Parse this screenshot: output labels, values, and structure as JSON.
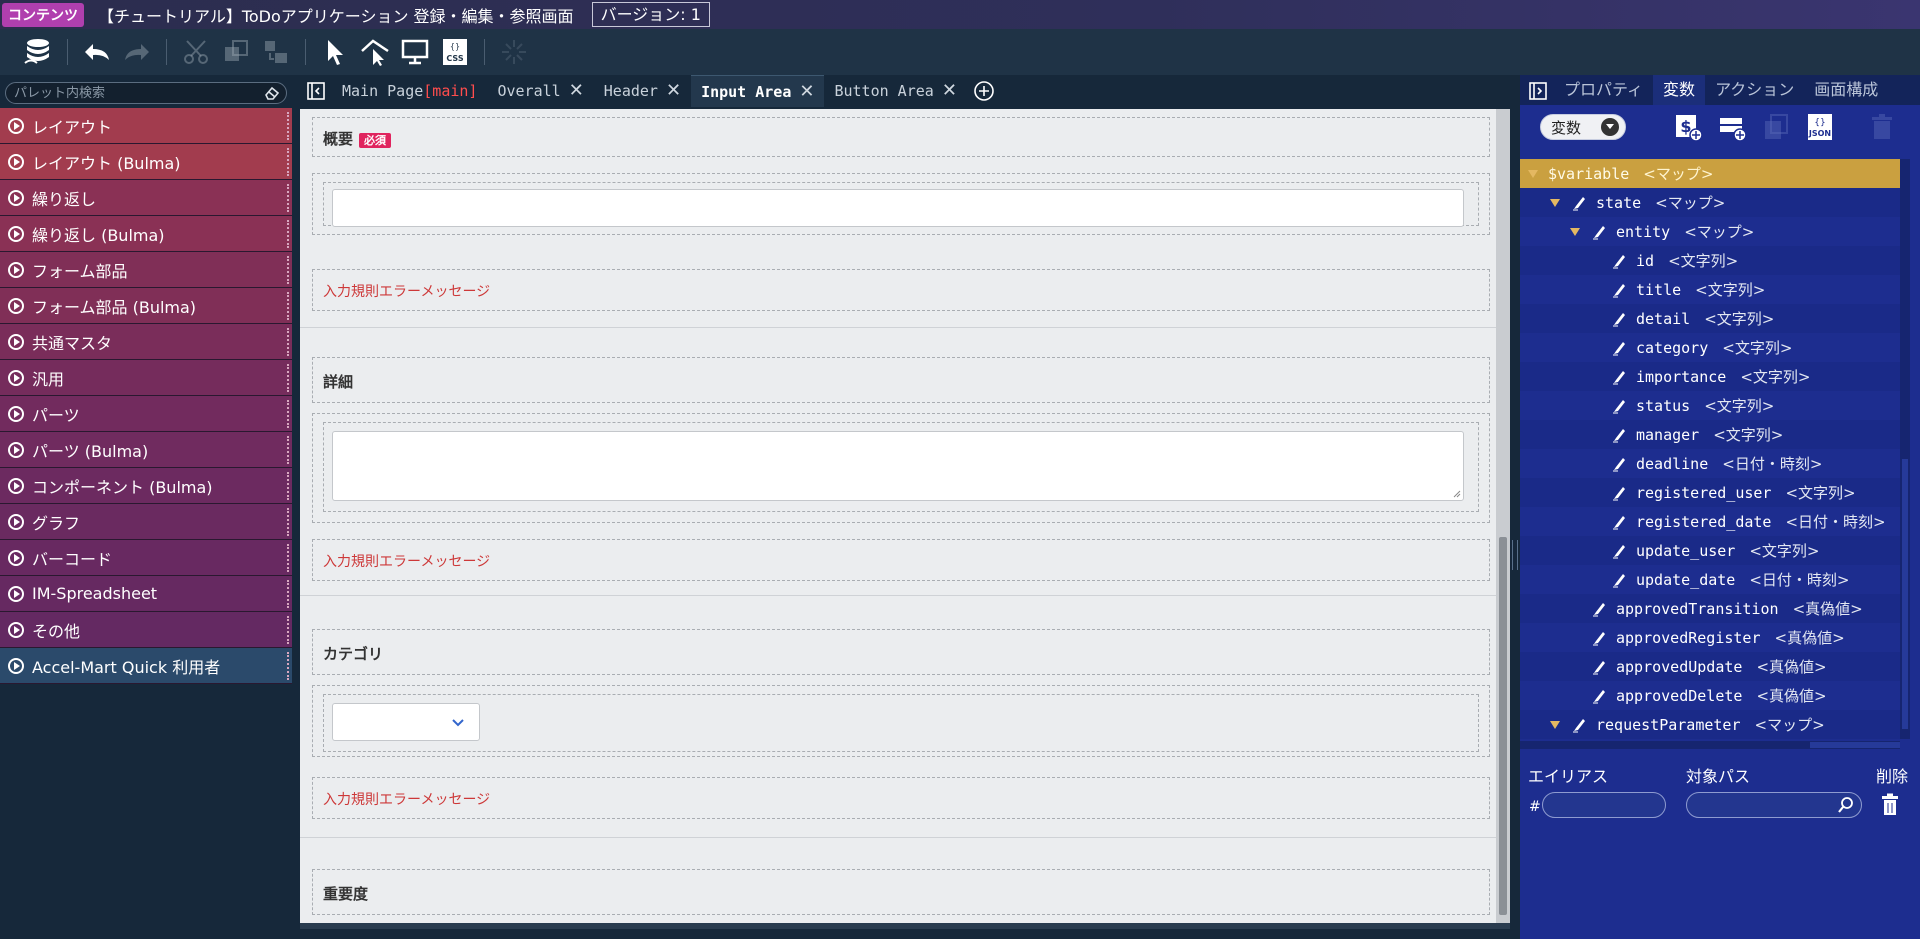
{
  "titlebar": {
    "badge": "コンテンツ",
    "title": "【チュートリアル】ToDoアプリケーション 登録・編集・参照画面",
    "version": "バージョン: 1"
  },
  "toolbar": {
    "icons": [
      "database-icon",
      "undo-icon",
      "redo-icon",
      "cut-icon",
      "copy-icon",
      "paste-icon",
      "select-icon",
      "multi-select-icon",
      "preview-icon",
      "css-icon",
      "loading-icon"
    ],
    "css_label": "CSS"
  },
  "palette": {
    "search_placeholder": "パレット内検索",
    "items": [
      {
        "label": "レイアウト",
        "color": "#a23c4e"
      },
      {
        "label": "レイアウト (Bulma)",
        "color": "#a23c4e"
      },
      {
        "label": "繰り返し",
        "color": "#8a3155"
      },
      {
        "label": "繰り返し (Bulma)",
        "color": "#8a3155"
      },
      {
        "label": "フォーム部品",
        "color": "#802f57"
      },
      {
        "label": "フォーム部品 (Bulma)",
        "color": "#802f57"
      },
      {
        "label": "共通マスタ",
        "color": "#7a2d5a"
      },
      {
        "label": "汎用",
        "color": "#752c5c"
      },
      {
        "label": "パーツ",
        "color": "#722b5e"
      },
      {
        "label": "パーツ (Bulma)",
        "color": "#702b5f"
      },
      {
        "label": "コンポーネント (Bulma)",
        "color": "#6c2a60"
      },
      {
        "label": "グラフ",
        "color": "#6a2a60"
      },
      {
        "label": "バーコード",
        "color": "#682961"
      },
      {
        "label": "IM-Spreadsheet",
        "color": "#662961"
      },
      {
        "label": "その他",
        "color": "#642962"
      },
      {
        "label": "Accel-Mart Quick 利用者",
        "color": "#2b4a6b"
      }
    ]
  },
  "tabs": [
    {
      "label": "Main Page",
      "tag": "[main]",
      "closable": false
    },
    {
      "label": "Overall",
      "closable": true
    },
    {
      "label": "Header",
      "closable": true
    },
    {
      "label": "Input Area",
      "closable": true,
      "active": true
    },
    {
      "label": "Button Area",
      "closable": true
    }
  ],
  "form": {
    "summary_label": "概要",
    "required_badge": "必須",
    "detail_label": "詳細",
    "category_label": "カテゴリ",
    "importance_label": "重要度",
    "error_message": "入力規則エラーメッセージ"
  },
  "rpanel": {
    "tabs": [
      "プロパティ",
      "変数",
      "アクション",
      "画面構成"
    ],
    "active_tab": "変数",
    "select_value": "変数",
    "json_label": "JSON",
    "tree": [
      {
        "key": "$variable",
        "type": "<マップ>",
        "indent": 0,
        "arrow": true,
        "pen": false,
        "root": true
      },
      {
        "key": "state",
        "type": "<マップ>",
        "indent": 1,
        "arrow": true,
        "pen": true
      },
      {
        "key": "entity",
        "type": "<マップ>",
        "indent": 2,
        "arrow": true,
        "pen": true
      },
      {
        "key": "id",
        "type": "<文字列>",
        "indent": 3,
        "arrow": false,
        "pen": true
      },
      {
        "key": "title",
        "type": "<文字列>",
        "indent": 3,
        "arrow": false,
        "pen": true
      },
      {
        "key": "detail",
        "type": "<文字列>",
        "indent": 3,
        "arrow": false,
        "pen": true
      },
      {
        "key": "category",
        "type": "<文字列>",
        "indent": 3,
        "arrow": false,
        "pen": true
      },
      {
        "key": "importance",
        "type": "<文字列>",
        "indent": 3,
        "arrow": false,
        "pen": true
      },
      {
        "key": "status",
        "type": "<文字列>",
        "indent": 3,
        "arrow": false,
        "pen": true
      },
      {
        "key": "manager",
        "type": "<文字列>",
        "indent": 3,
        "arrow": false,
        "pen": true
      },
      {
        "key": "deadline",
        "type": "<日付・時刻>",
        "indent": 3,
        "arrow": false,
        "pen": true
      },
      {
        "key": "registered_user",
        "type": "<文字列>",
        "indent": 3,
        "arrow": false,
        "pen": true
      },
      {
        "key": "registered_date",
        "type": "<日付・時刻>",
        "indent": 3,
        "arrow": false,
        "pen": true
      },
      {
        "key": "update_user",
        "type": "<文字列>",
        "indent": 3,
        "arrow": false,
        "pen": true
      },
      {
        "key": "update_date",
        "type": "<日付・時刻>",
        "indent": 3,
        "arrow": false,
        "pen": true
      },
      {
        "key": "approvedTransition",
        "type": "<真偽値>",
        "indent": 2,
        "arrow": false,
        "pen": true
      },
      {
        "key": "approvedRegister",
        "type": "<真偽値>",
        "indent": 2,
        "arrow": false,
        "pen": true
      },
      {
        "key": "approvedUpdate",
        "type": "<真偽値>",
        "indent": 2,
        "arrow": false,
        "pen": true
      },
      {
        "key": "approvedDelete",
        "type": "<真偽値>",
        "indent": 2,
        "arrow": false,
        "pen": true
      },
      {
        "key": "requestParameter",
        "type": "<マップ>",
        "indent": 1,
        "arrow": true,
        "pen": true
      }
    ],
    "alias": {
      "col_alias": "エイリアス",
      "col_path": "対象パス",
      "col_delete": "削除",
      "hash": "#",
      "alias_value": "",
      "path_value": ""
    }
  }
}
